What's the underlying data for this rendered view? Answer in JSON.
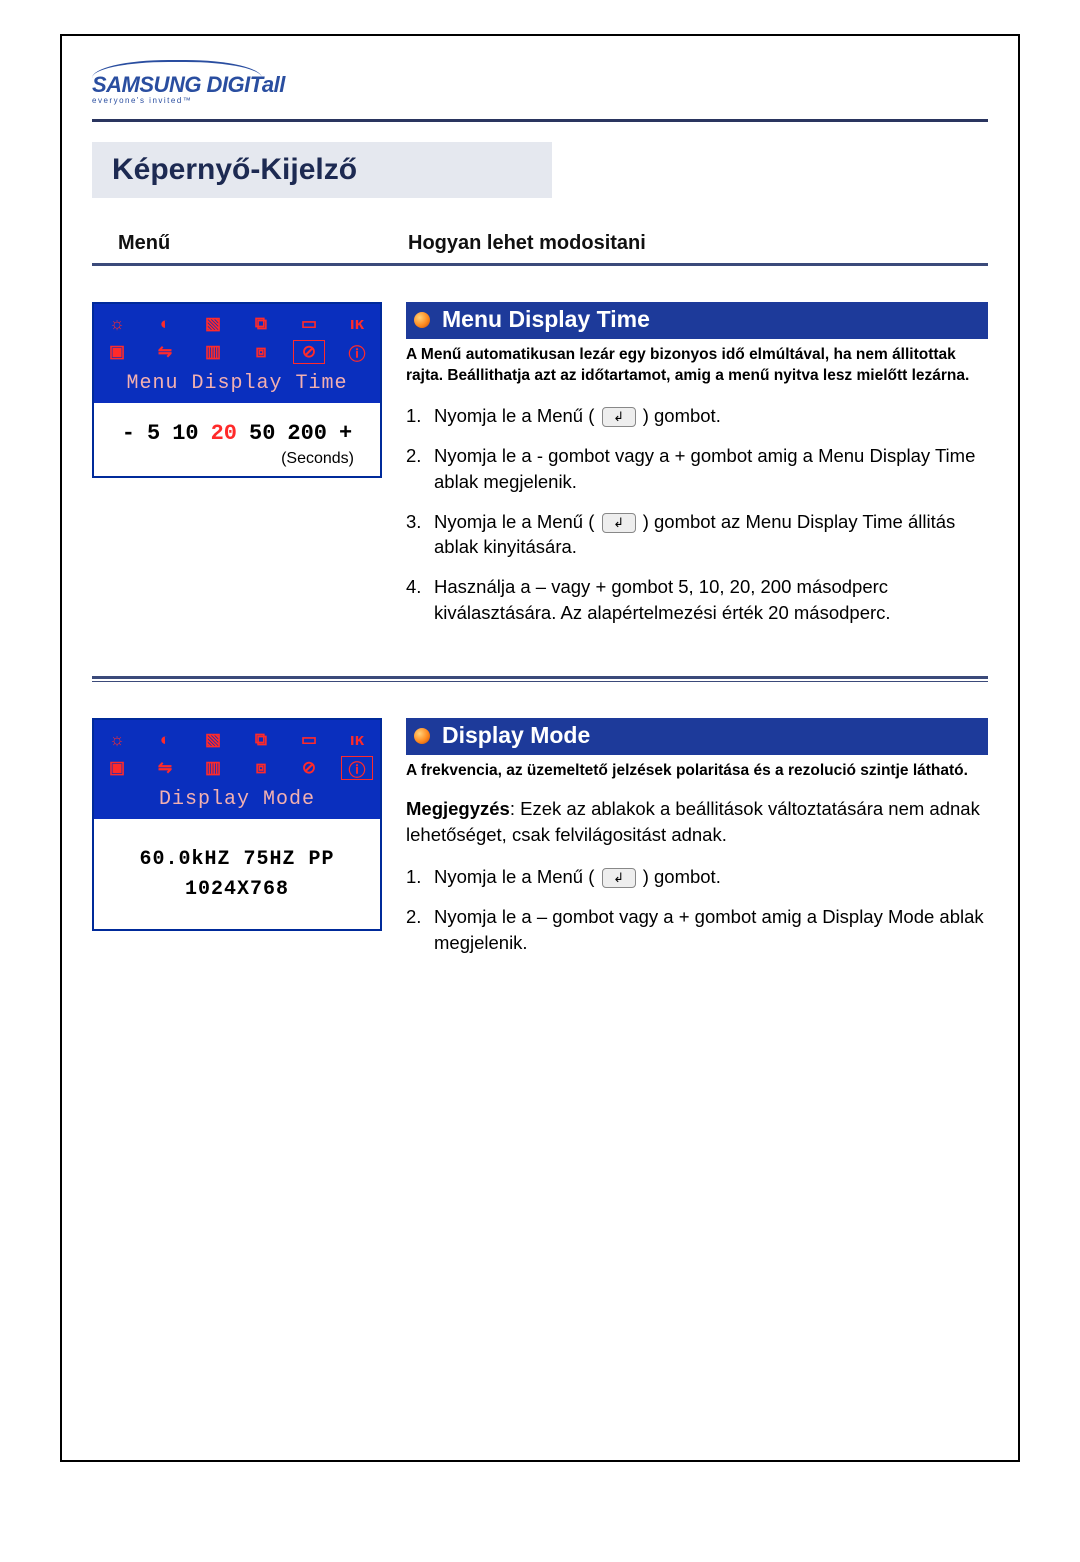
{
  "logo": {
    "brand": "SAMSUNG DIGITall",
    "tagline": "everyone's invited™"
  },
  "page_title": "Képernyő-Kijelző",
  "columns": {
    "left": "Menű",
    "right": "Hogyan lehet modositani"
  },
  "section1": {
    "osd_title": "Menu Display Time",
    "osd_values": {
      "minus": "-",
      "v1": "5",
      "v2": "10",
      "v3": "20",
      "v4": "50",
      "v5": "200",
      "plus": "+",
      "unit": "(Seconds)"
    },
    "header": "Menu Display Time",
    "desc": "A Menű automatikusan lezár egy bizonyos idő elmúltával, ha nem állitottak rajta. Beállithatja azt az időtartamot, amig a menű nyitva lesz mielőtt lezárna.",
    "steps": {
      "s1a": "Nyomja le a Menű  (",
      "s1b": ") gombot.",
      "s2": "Nyomja le a - gombot vagy a + gombot amig a Menu Display Time ablak megjelenik.",
      "s3a": "Nyomja le a Menű (",
      "s3b": ") gombot az Menu Display Time állitás ablak kinyitására.",
      "s4": "Használja a – vagy + gombot 5, 10, 20, 200 másodperc kiválasztására. Az alapértelmezési érték 20 másodperc."
    }
  },
  "section2": {
    "osd_title": "Display Mode",
    "osd_readout1": "60.0kHZ 75HZ PP",
    "osd_readout2": "1024X768",
    "header": "Display Mode",
    "desc": "A frekvencia, az üzemeltető jelzések polaritása és a rezolució szintje látható.",
    "note_label": "Megjegyzés",
    "note_text": ": Ezek az ablakok a beállitások változtatására nem adnak lehetőséget, csak felvilágositást adnak.",
    "steps": {
      "s1a": "Nyomja le a Menű  (",
      "s1b": ") gombot.",
      "s2": "Nyomja le a – gombot vagy a + gombot amig a Display Mode ablak megjelenik."
    }
  }
}
